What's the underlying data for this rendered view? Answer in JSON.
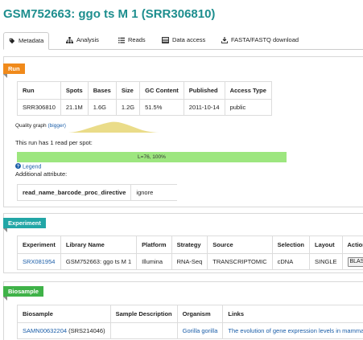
{
  "title": "GSM752663: ggo ts M 1 (SRR306810)",
  "tabs": [
    {
      "label": "Metadata",
      "icon": "tag-icon",
      "active": true
    },
    {
      "label": "Analysis",
      "icon": "sitemap-icon"
    },
    {
      "label": "Reads",
      "icon": "list-icon"
    },
    {
      "label": "Data access",
      "icon": "server-icon"
    },
    {
      "label": "FASTA/FASTQ download",
      "icon": "download-icon"
    }
  ],
  "colors": {
    "run": "#f08a1b",
    "experiment": "#22a6a6",
    "biosample": "#3fb248",
    "title": "#1d8e8e",
    "length_bar": "#9de67f",
    "histogram": "#eadc89"
  },
  "run": {
    "ribbon": "Run",
    "headers": [
      "Run",
      "Spots",
      "Bases",
      "Size",
      "GC Content",
      "Published",
      "Access Type"
    ],
    "row": [
      "SRR306810",
      "21.1M",
      "1.6G",
      "1.2G",
      "51.5%",
      "2011-10-14",
      "public"
    ],
    "quality_label": "Quality graph",
    "quality_link": "(bigger)",
    "reads_per_spot": "This run has 1 read per spot:",
    "length_bar_label": "L=76, 100%",
    "length_bar_fraction": 1.0,
    "legend": "Legend",
    "additional": "Additional attribute:",
    "attr_name": "read_name_barcode_proc_directive",
    "attr_value": "ignore"
  },
  "experiment": {
    "ribbon": "Experiment",
    "headers": [
      "Experiment",
      "Library Name",
      "Platform",
      "Strategy",
      "Source",
      "Selection",
      "Layout",
      "Action"
    ],
    "row": [
      "SRX081954",
      "GSM752663: ggo ts M 1",
      "Illumina",
      "RNA-Seq",
      "TRANSCRIPTOMIC",
      "cDNA",
      "SINGLE",
      "BLAST"
    ]
  },
  "biosample": {
    "ribbon": "Biosample",
    "headers": [
      "Biosample",
      "Sample Description",
      "Organism",
      "Links"
    ],
    "biosample_link": "SAMN00632204",
    "biosample_extra": "(SRS214046)",
    "description": "",
    "organism": "Gorilla gorilla",
    "links": "The evolution of gene expression levels in mamma"
  }
}
